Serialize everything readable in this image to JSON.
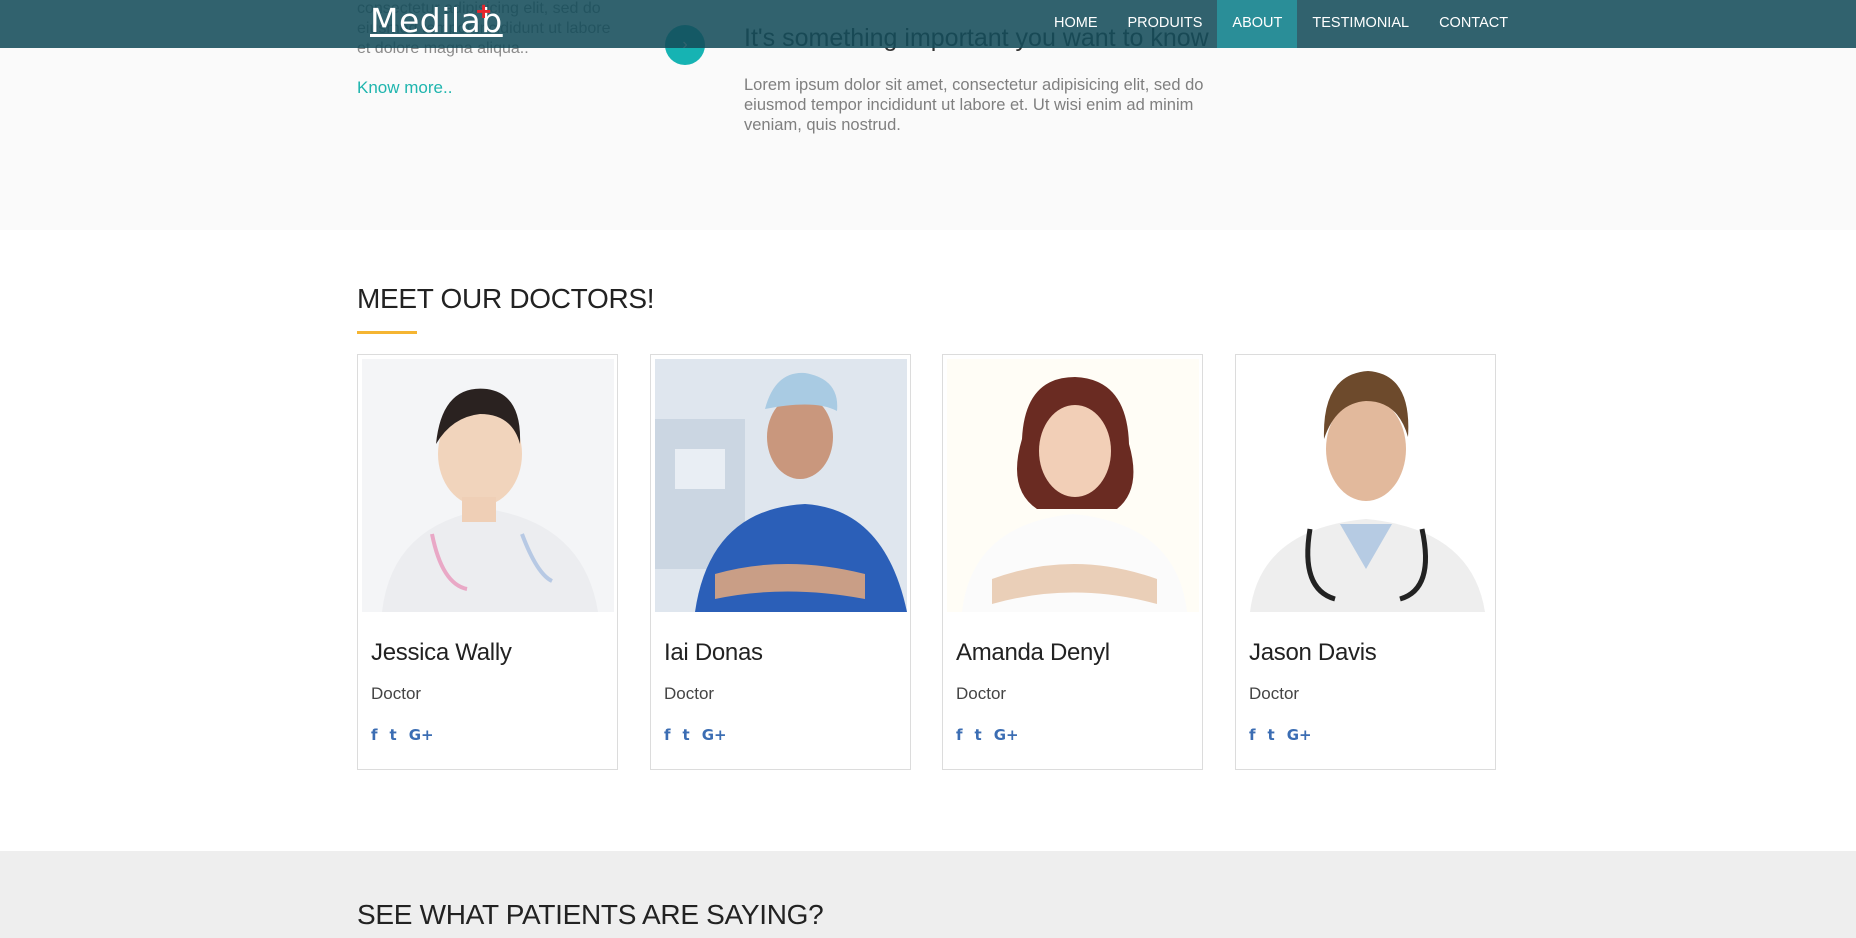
{
  "brand": {
    "name": "Medilab",
    "cross": "+",
    "cross_color": "#e8252d"
  },
  "nav": {
    "items": [
      {
        "label": "HOME",
        "active": false
      },
      {
        "label": "PRODUITS",
        "active": false
      },
      {
        "label": "ABOUT",
        "active": true
      },
      {
        "label": "TESTIMONIAL",
        "active": false
      },
      {
        "label": "CONTACT",
        "active": false
      }
    ]
  },
  "about": {
    "left_text": "consectetur adipisicing elit, sed do eiusmod tempor incididunt ut labore et dolore magna aliqua..",
    "know_more": "Know more..",
    "circle_icon": "chevron-right-icon",
    "heading": "It's something important you want to know",
    "body": "Lorem ipsum dolor sit amet, consectetur adipisicing elit, sed do eiusmod tempor incididunt ut labore et. Ut wisi enim ad minim veniam, quis nostrud."
  },
  "doctors": {
    "title": "MEET OUR DOCTORS!",
    "accent": "#f5b532",
    "list": [
      {
        "name": "Jessica Wally",
        "role": "Doctor"
      },
      {
        "name": "Iai Donas",
        "role": "Doctor"
      },
      {
        "name": "Amanda Denyl",
        "role": "Doctor"
      },
      {
        "name": "Jason Davis",
        "role": "Doctor"
      }
    ],
    "social_icons": [
      "facebook-icon",
      "twitter-icon",
      "google-plus-icon"
    ]
  },
  "testimonials": {
    "title": "SEE WHAT PATIENTS ARE SAYING?"
  },
  "colors": {
    "nav_bg": "#144c5a",
    "nav_active": "#2a8e98",
    "link": "#1fb5ae",
    "social": "#3b6db3"
  }
}
